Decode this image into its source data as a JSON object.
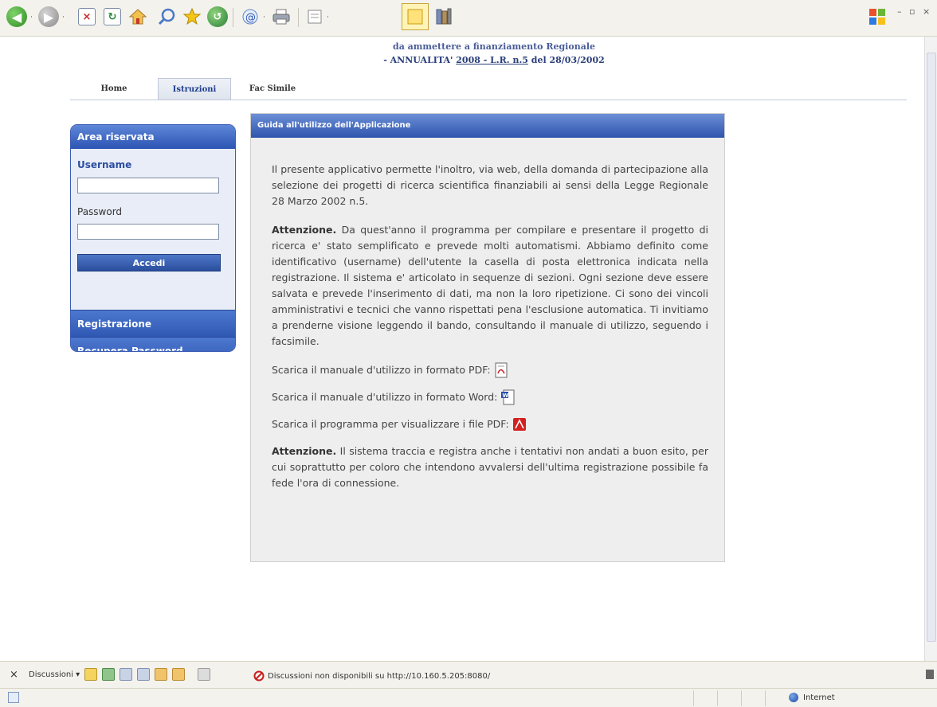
{
  "header": {
    "line1": "da ammettere a finanziamento Regionale",
    "line2_prefix": "- ANNUALITA' ",
    "line2_link": "2008 - L.R. n.5",
    "line2_suffix": " del 28/03/2002"
  },
  "nav": {
    "tabs": [
      "Home",
      "Istruzioni",
      "Fac Simile"
    ],
    "active": "Istruzioni"
  },
  "sidebar": {
    "title": "Area riservata",
    "username_label": "Username",
    "password_label": "Password",
    "login_button": "Accedi",
    "links": [
      "Registrazione",
      "Recupera Password"
    ]
  },
  "content": {
    "title": "Guida all'utilizzo dell'Applicazione",
    "intro": "Il presente applicativo permette l'inoltro, via web, della domanda di partecipazione alla selezione dei progetti di ricerca scientifica finanziabili ai sensi della Legge Regionale 28 Marzo 2002 n.5.",
    "attention1_label": "Attenzione.",
    "attention1_text": " Da quest'anno il programma per compilare e presentare il progetto di ricerca e' stato semplificato e prevede molti automatismi. Abbiamo definito come identificativo (username) dell'utente la casella di posta elettronica indicata nella registrazione. Il sistema e' articolato in sequenze di sezioni. Ogni sezione deve essere salvata e prevede l'inserimento di dati, ma non la loro ripetizione. Ci sono dei vincoli amministrativi e tecnici che vanno rispettati pena l'esclusione automatica. Ti invitiamo a prenderne visione leggendo il bando, consultando il manuale di utilizzo, seguendo i facsimile.",
    "downloads": [
      {
        "label": "Scarica il manuale d'utilizzo in formato PDF:",
        "icon": "pdf-document-icon"
      },
      {
        "label": "Scarica il manuale d'utilizzo in formato Word:",
        "icon": "word-document-icon"
      },
      {
        "label": "Scarica il programma per visualizzare i file PDF:",
        "icon": "adobe-reader-icon"
      }
    ],
    "attention2_label": "Attenzione.",
    "attention2_text": " Il sistema traccia e registra anche i tentativi non andati a buon esito, per cui soprattutto per coloro che intendono avvalersi dell'ultima registrazione possibile fa fede l'ora di connessione."
  },
  "discussion_bar": {
    "label": "Discussioni ▾",
    "message": "Discussioni non disponibili su http://10.160.5.205:8080/"
  },
  "status_bar": {
    "zone": "Internet"
  },
  "colors": {
    "accent": "#2f54ad",
    "sidebar_bg": "#e8edf7",
    "content_bg": "#eeeeee"
  }
}
